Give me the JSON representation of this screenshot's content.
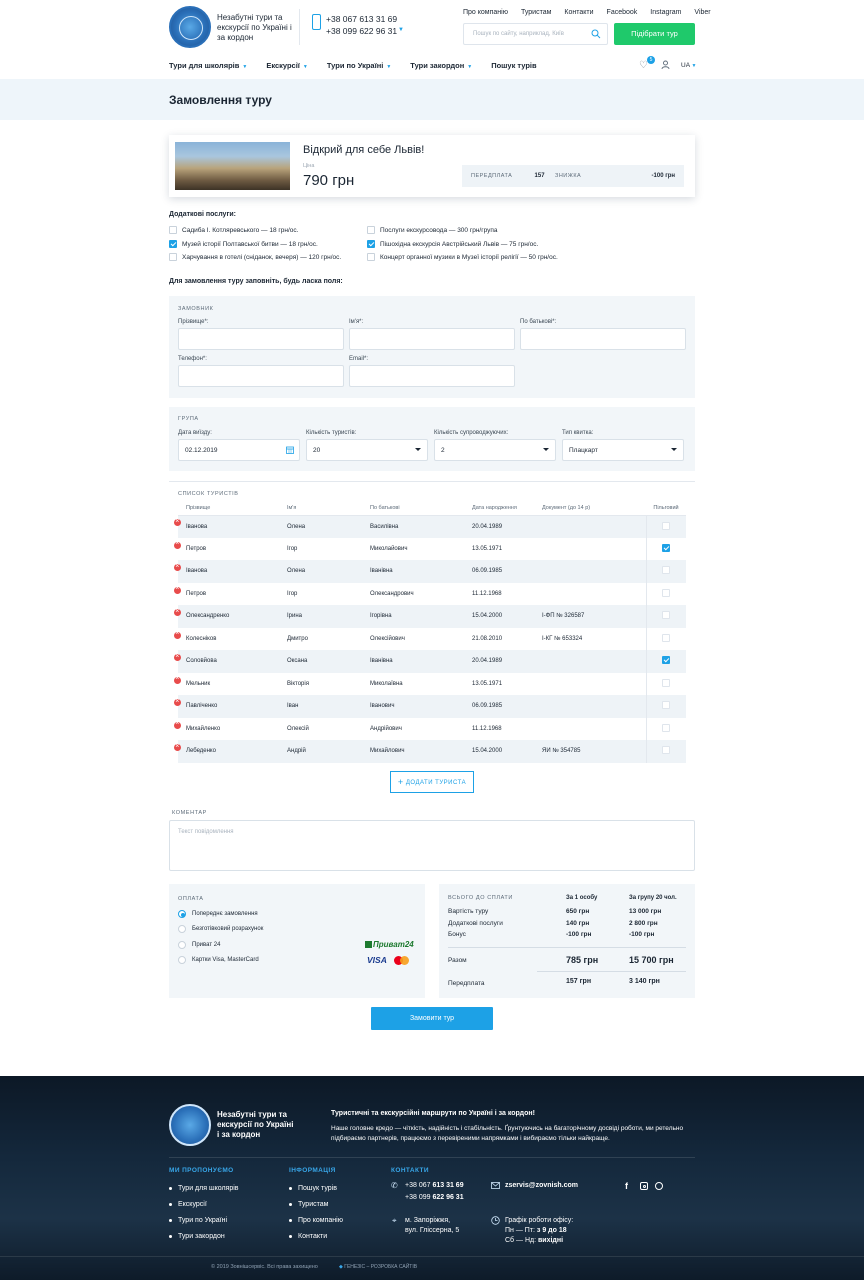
{
  "header": {
    "tagline": "Незабутні тури та екскурсії по Україні і за кордон",
    "phone1": "+38 067 613 31 69",
    "phone2": "+38 099 622 96 31",
    "top_links": [
      "Про компанію",
      "Туристам",
      "Контакти",
      "Facebook",
      "Instagram",
      "Viber"
    ],
    "search_placeholder": "Пошук по сайту, наприклад, Київ",
    "pick_tour": "Підібрати тур",
    "nav": [
      {
        "label": "Тури для школярів",
        "dropdown": true
      },
      {
        "label": "Екскурсії",
        "dropdown": true
      },
      {
        "label": "Тури по Україні",
        "dropdown": true
      },
      {
        "label": "Тури закордон",
        "dropdown": true
      },
      {
        "label": "Пошук турів",
        "dropdown": false
      }
    ],
    "favorites_count": "5",
    "lang": "UA"
  },
  "page_title": "Замовлення туру",
  "tour": {
    "name": "Відкрий для себе Львів!",
    "price_label": "Ціна",
    "price": "790 грн",
    "prepay_label": "ПЕРЕДПЛАТА",
    "prepay_value": "157 грн",
    "discount_label": "ЗНИЖКА",
    "discount_value": "-100 грн"
  },
  "services": {
    "title": "Додаткові послуги:",
    "left": [
      {
        "label": "Садиба І. Котляревського — 18 грн/ос.",
        "checked": false
      },
      {
        "label": "Музей історії Полтавської битви — 18 грн/ос.",
        "checked": true
      },
      {
        "label": "Харчування в готелі (сніданок, вечеря) — 120 грн/ос.",
        "checked": false
      }
    ],
    "right": [
      {
        "label": "Послуги екскурсовода — 300 грн/група",
        "checked": false
      },
      {
        "label": "Пішохідна екскурсія Австрійський Львів — 75 грн/ос.",
        "checked": true
      },
      {
        "label": "Концерт органної музики в Музеї історії релігії — 50 грн/ос.",
        "checked": false
      }
    ]
  },
  "form_intro": "Для замовлення туру заповніть, будь ласка поля:",
  "customer": {
    "section": "ЗАМОВНИК",
    "surname": "Прізвище*:",
    "name": "Ім'я*:",
    "patronymic": "По батькові*:",
    "phone": "Телефон*:",
    "email": "Email*:"
  },
  "group": {
    "section": "ГРУПА",
    "date_label": "Дата виїзду:",
    "date_value": "02.12.2019",
    "tourists_label": "Кількість туристів:",
    "tourists_value": "20",
    "escorts_label": "Кількість супроводжуючих:",
    "escorts_value": "2",
    "ticket_label": "Тип квитка:",
    "ticket_value": "Плацкарт"
  },
  "tourists": {
    "section": "СПИСОК ТУРИСТІВ",
    "columns": [
      "Прізвище",
      "Ім'я",
      "По батькові",
      "Дата народження",
      "Документ (до 14 р)",
      "Пільговий"
    ],
    "rows": [
      {
        "surname": "Іванова",
        "name": "Олена",
        "patronymic": "Василівна",
        "birth": "20.04.1989",
        "doc": "",
        "benefit": false
      },
      {
        "surname": "Петров",
        "name": "Ігор",
        "patronymic": "Миколайович",
        "birth": "13.05.1971",
        "doc": "",
        "benefit": true
      },
      {
        "surname": "Іванова",
        "name": "Олена",
        "patronymic": "Іванівна",
        "birth": "06.09.1985",
        "doc": "",
        "benefit": false
      },
      {
        "surname": "Петров",
        "name": "Ігор",
        "patronymic": "Олександрович",
        "birth": "11.12.1968",
        "doc": "",
        "benefit": false
      },
      {
        "surname": "Олександренко",
        "name": "Ірина",
        "patronymic": "Ігорівна",
        "birth": "15.04.2000",
        "doc": "І-ФП № 326587",
        "benefit": false
      },
      {
        "surname": "Колесніков",
        "name": "Дмитро",
        "patronymic": "Олексійович",
        "birth": "21.08.2010",
        "doc": "І-КГ № 653324",
        "benefit": false
      },
      {
        "surname": "Соловйова",
        "name": "Оксана",
        "patronymic": "Іванівна",
        "birth": "20.04.1989",
        "doc": "",
        "benefit": true
      },
      {
        "surname": "Мельник",
        "name": "Вікторія",
        "patronymic": "Миколаївна",
        "birth": "13.05.1971",
        "doc": "",
        "benefit": false
      },
      {
        "surname": "Павліченко",
        "name": "Іван",
        "patronymic": "Іванович",
        "birth": "06.09.1985",
        "doc": "",
        "benefit": false
      },
      {
        "surname": "Михайленко",
        "name": "Олексій",
        "patronymic": "Андрійович",
        "birth": "11.12.1968",
        "doc": "",
        "benefit": false
      },
      {
        "surname": "Лебеденко",
        "name": "Андрій",
        "patronymic": "Михайлович",
        "birth": "15.04.2000",
        "doc": "ЯИ № 354785",
        "benefit": false
      }
    ],
    "add_button": "ДОДАТИ ТУРИСТА"
  },
  "comment": {
    "section": "КОМЕНТАР",
    "placeholder": "Текст повідомлення"
  },
  "payment": {
    "section": "ОПЛАТА",
    "options": [
      {
        "label": "Попереднє замовлення",
        "selected": true
      },
      {
        "label": "Безготівковий розрахунок",
        "selected": false
      },
      {
        "label": "Приват 24",
        "selected": false
      },
      {
        "label": "Картки Visa, MasterCard",
        "selected": false
      }
    ],
    "privat_logo": "Приват24",
    "visa_logo": "VISA"
  },
  "summary": {
    "title": "ВСЬОГО ДО СПЛАТИ",
    "col1": "За 1 особу",
    "col2": "За групу 20 чол.",
    "rows": [
      {
        "label": "Вартість туру",
        "v1": "650 грн",
        "v2": "13 000 грн"
      },
      {
        "label": "Додаткові послуги",
        "v1": "140 грн",
        "v2": "2 800 грн"
      },
      {
        "label": "Бонус",
        "v1": "-100 грн",
        "v2": "-100 грн"
      }
    ],
    "total_label": "Разом",
    "total_v1": "785 грн",
    "total_v2": "15 700 грн",
    "prepay_label": "Передплата",
    "prepay_v1": "157 грн",
    "prepay_v2": "3 140 грн"
  },
  "order_button": "Замовити тур",
  "footer": {
    "tagline": "Незабутні тури та екскурсії по Україні і за кордон",
    "about_title": "Туристичні та екскурсійні маршрути по Україні і за кордон!",
    "about_text": "Наше головне кредо — чіткість, надійність і стабільність. Ґрунтуючись на багаторічному досвіді роботи, ми ретельно підбираємо партнерів, працюємо з перевіреними напрямками і вибираємо тільки найкраще.",
    "offer_title": "МИ ПРОПОНУЄМО",
    "offer_links": [
      "Тури для школярів",
      "Екскурсії",
      "Тури по Україні",
      "Тури закордон"
    ],
    "info_title": "ІНФОРМАЦІЯ",
    "info_links": [
      "Пошук турів",
      "Туристам",
      "Про компанію",
      "Контакти"
    ],
    "contacts_title": "КОНТАКТИ",
    "phone1_prefix": "+38 067 ",
    "phone1_bold": "613 31 69",
    "phone2_prefix": "+38 099 ",
    "phone2_bold": "622 96 31",
    "email": "zservis@zovnish.com",
    "address1": "м. Запоріжжя,",
    "address2": "вул. Гліссерна, 5",
    "schedule_title": "Графік роботи офісу:",
    "schedule1_prefix": "Пн — Пт: ",
    "schedule1_bold": "з 9 до 18",
    "schedule2_prefix": "Сб — Нд: ",
    "schedule2_bold": "вихідні",
    "copyright": "© 2019 Зовнішсервіс. Всі права захищено",
    "dev": "ГЕНЕЗІС – РОЗРОБКА САЙТІВ"
  }
}
